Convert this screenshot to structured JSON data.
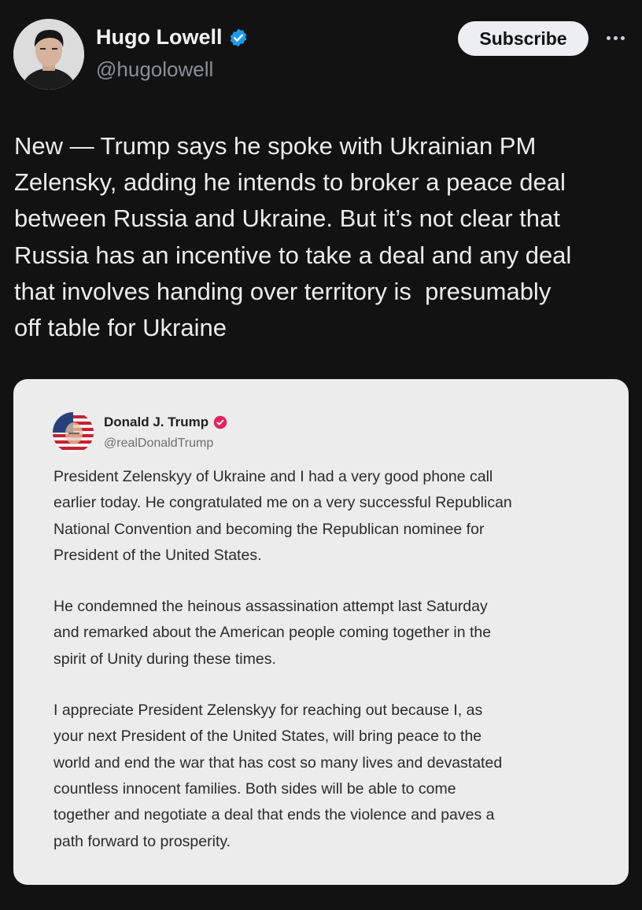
{
  "post": {
    "author": {
      "name": "Hugo Lowell",
      "handle": "@hugolowell",
      "verified_color": "#1d9bf0"
    },
    "subscribe_label": "Subscribe",
    "more_icon": "more-horizontal-icon",
    "text": "New — Trump says he spoke with Ukrainian PM\nZelensky, adding he intends to broker a peace deal\nbetween Russia and Ukraine. But it’s not clear that\nRussia has an incentive to take a deal and any deal\nthat involves handing over territory is  presumably\noff table for Ukraine"
  },
  "quote": {
    "author": {
      "name": "Donald J. Trump",
      "handle": "@realDonaldTrump",
      "verified_color": "#e0245e"
    },
    "paragraphs": [
      "President Zelenskyy of Ukraine and I had a very good phone call\nearlier today. He congratulated me on a very successful Republican\nNational Convention and becoming the Republican nominee for\nPresident of the United States.",
      "He condemned the heinous assassination attempt last Saturday\nand remarked about the American people coming together in the\nspirit of Unity during these times.",
      "I appreciate President Zelenskyy for reaching out because I, as\nyour next President of the United States, will bring peace to the\nworld and end the war that has cost so many lives and devastated\ncountless innocent families. Both sides will be able to come\ntogether and negotiate a deal that ends the violence and paves a\npath forward to prosperity."
    ]
  }
}
